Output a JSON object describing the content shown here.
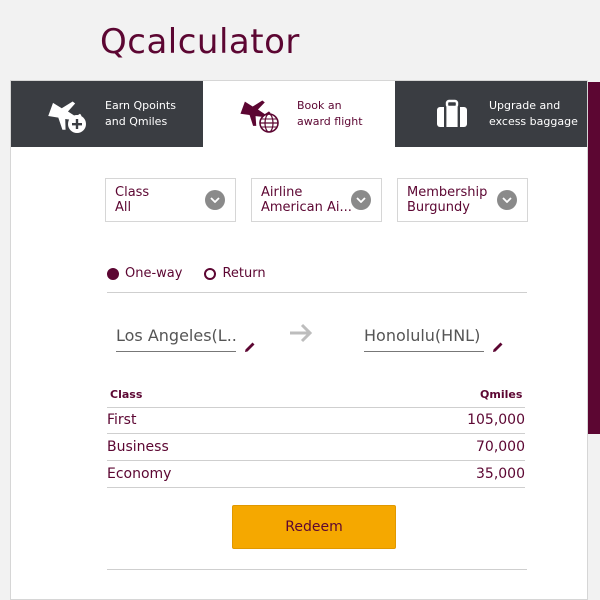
{
  "app": {
    "title": "Qcalculator"
  },
  "tabs": [
    {
      "line1": "Earn Qpoints",
      "line2": "and Qmiles",
      "icon": "plane-plus-icon"
    },
    {
      "line1": "Book an",
      "line2": "award flight",
      "icon": "plane-globe-icon"
    },
    {
      "line1": "Upgrade and",
      "line2": "excess baggage",
      "icon": "suitcase-icon"
    }
  ],
  "filters": {
    "class": {
      "label": "Class",
      "value": "All"
    },
    "airline": {
      "label": "Airline",
      "value": "American Ai..."
    },
    "membership": {
      "label": "Membership",
      "value": "Burgundy"
    }
  },
  "trip": {
    "one_way": "One-way",
    "return": "Return",
    "selected": "one_way"
  },
  "route": {
    "from": "Los Angeles(L...",
    "to": "Honolulu(HNL)"
  },
  "table": {
    "col_class": "Class",
    "col_qmiles": "Qmiles",
    "rows": [
      {
        "class": "First",
        "qmiles": "105,000"
      },
      {
        "class": "Business",
        "qmiles": "70,000"
      },
      {
        "class": "Economy",
        "qmiles": "35,000"
      }
    ]
  },
  "actions": {
    "redeem": "Redeem"
  },
  "colors": {
    "brand": "#5c0632",
    "tab_dark": "#3a3d42",
    "button": "#f5a800"
  }
}
